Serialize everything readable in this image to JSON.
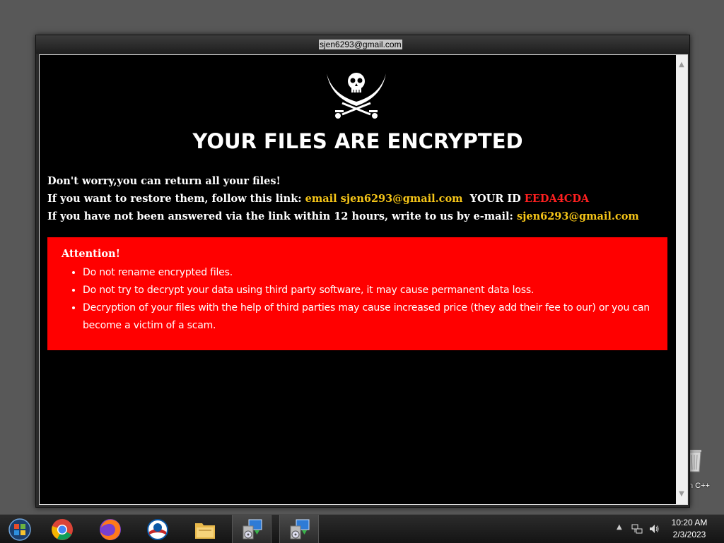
{
  "window": {
    "title": "sjen6293@gmail.com"
  },
  "headline": "YOUR FILES ARE ENCRYPTED",
  "message": {
    "line1": "Don't worry,you can return all your files!",
    "line2_prefix": "If you want to restore them, follow this link: ",
    "line2_link": "email sjen6293@gmail.com",
    "line2_id_label": "YOUR ID ",
    "line2_id_value": "EEDA4CDA",
    "line3_prefix": "If you have not been answered via the link within 12 hours, write to us by e-mail: ",
    "line3_email": "sjen6293@gmail.com"
  },
  "attention": {
    "title": "Attention!",
    "items": [
      "Do not rename encrypted files.",
      "Do not try to decrypt your data using third party software, it may cause permanent data loss.",
      "Decryption of your files with the help of third parties may cause increased price (they add their fee to our) or you can become a victim of a scam."
    ]
  },
  "desktop": {
    "icon_label": "n C++"
  },
  "taskbar": {
    "apps": [
      "start-orb-icon",
      "chrome-icon",
      "firefox-icon",
      "outlook-icon",
      "file-explorer-icon",
      "installer-icon",
      "installer-icon"
    ],
    "clock_time": "10:20 AM",
    "clock_date": "2/3/2023"
  },
  "colors": {
    "accent_red": "#ff0000",
    "link_gold": "#f5c518",
    "id_red": "#ff2020"
  }
}
